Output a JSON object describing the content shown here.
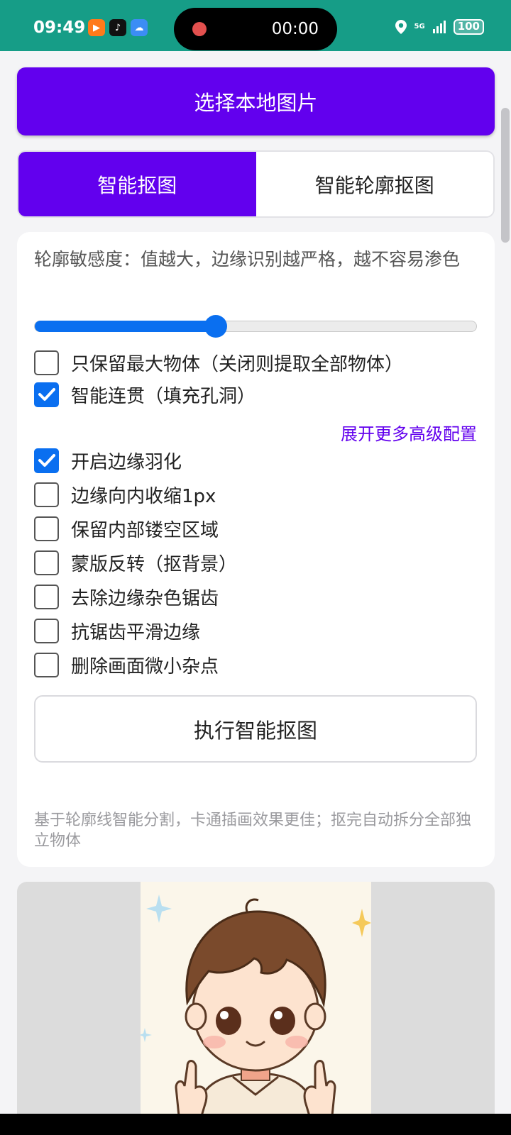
{
  "status_bar": {
    "time": "09:49",
    "recording_timer": "00:00",
    "network": "5G",
    "battery": "100",
    "colors": {
      "background": "#169d87",
      "record_dot": "#e2504e"
    }
  },
  "toolbar": {
    "select_image_label": "选择本地图片"
  },
  "tabs": [
    {
      "label": "智能抠图",
      "active": true
    },
    {
      "label": "智能轮廓抠图",
      "active": false
    }
  ],
  "settings": {
    "sensitivity_label": "轮廓敏感度：值越大，边缘识别越严格，越不容易渗色",
    "sensitivity_value": 0.41,
    "options_top": [
      {
        "label": "只保留最大物体（关闭则提取全部物体）",
        "checked": false
      },
      {
        "label": "智能连贯（填充孔洞）",
        "checked": true
      }
    ],
    "expand_label": "展开更多高级配置",
    "options_advanced": [
      {
        "label": "开启边缘羽化",
        "checked": true
      },
      {
        "label": "边缘向内收缩1px",
        "checked": false
      },
      {
        "label": "保留内部镂空区域",
        "checked": false
      },
      {
        "label": "蒙版反转（抠背景）",
        "checked": false
      },
      {
        "label": "去除边缘杂色锯齿",
        "checked": false
      },
      {
        "label": "抗锯齿平滑边缘",
        "checked": false
      },
      {
        "label": "删除画面微小杂点",
        "checked": false
      }
    ],
    "run_label": "执行智能抠图",
    "hint": "基于轮廓线智能分割，卡通插画效果更佳；抠完自动拆分全部独立物体"
  },
  "colors": {
    "accent": "#6200ee",
    "control_blue": "#0a6ff0"
  },
  "preview": {
    "icon": "cartoon-boy-image"
  }
}
